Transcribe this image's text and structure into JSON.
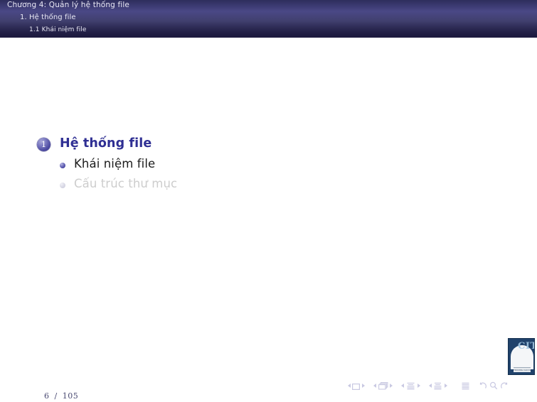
{
  "header": {
    "title": "Chương 4: Quản lý hệ thống file",
    "section": "1. Hệ thống file",
    "subsection": "1.1 Khái niệm file"
  },
  "outline": {
    "sections": [
      {
        "number": "1",
        "label": "Hệ thống file",
        "state": "active",
        "subsections": [
          {
            "label": "Khái niệm file",
            "state": "active"
          },
          {
            "label": "Cấu trúc thư mục",
            "state": "dim"
          }
        ]
      }
    ]
  },
  "footer": {
    "page_current": "6",
    "page_separator": "/",
    "page_total": "105"
  },
  "navigation_symbols": {
    "groups": [
      {
        "icon": "slide-icon",
        "label": "Slide"
      },
      {
        "icon": "frame-icon",
        "label": "Frame"
      },
      {
        "icon": "subsection-icon",
        "label": "Subsection"
      },
      {
        "icon": "section-icon",
        "label": "Section"
      },
      {
        "icon": "presentation-icon",
        "label": "Presentation"
      }
    ],
    "extras": [
      {
        "icon": "back-icon",
        "label": "Back"
      },
      {
        "icon": "find-icon",
        "label": "Find"
      },
      {
        "icon": "forward-icon",
        "label": "Forward"
      }
    ]
  },
  "logo": {
    "letters": "CIT",
    "banner_text": "TRUONG CAO DANG"
  },
  "colors": {
    "header_top": "#2e2d5c",
    "header_mid": "#4a4886",
    "header_bottom": "#1d1a3e",
    "section_title": "#2f2f93",
    "subsection_active": "#1c1c1c",
    "subsection_dim": "#cdcdcd",
    "badge_fill": "#4b49a0",
    "nav_symbol": "#c9c9e2",
    "logo_border": "#20426b"
  }
}
